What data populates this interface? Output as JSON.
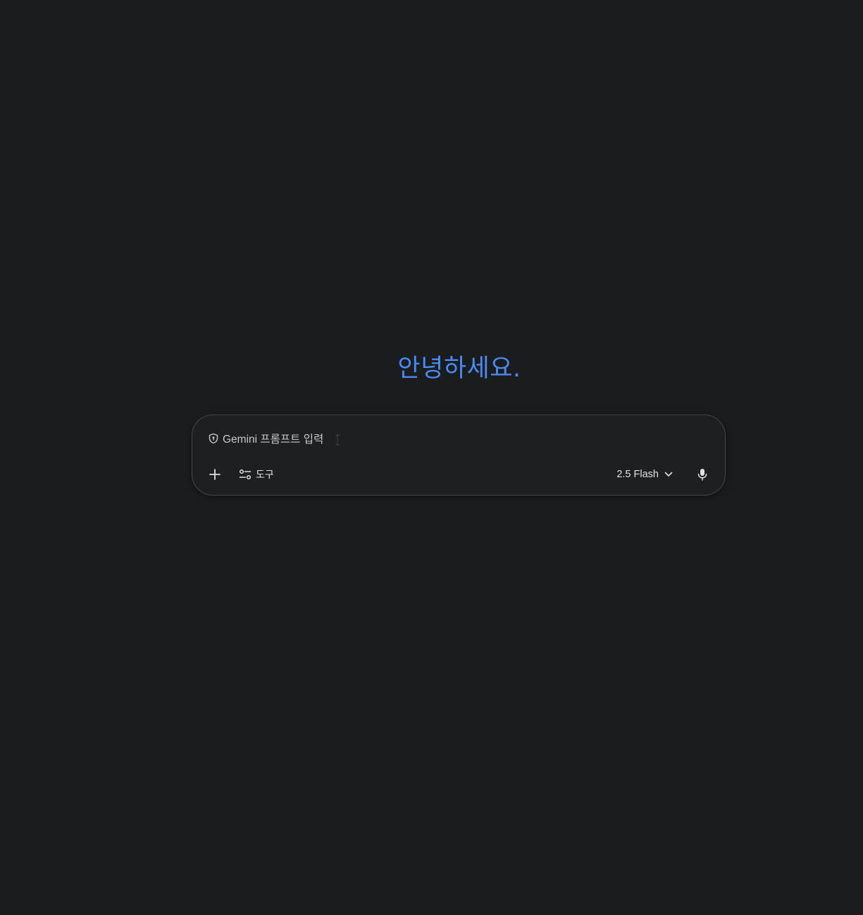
{
  "main": {
    "greeting": "안녕하세요."
  },
  "prompt": {
    "placeholder": "Gemini 프롬프트 입력"
  },
  "toolbar": {
    "add_icon": "plus-icon",
    "tools_icon": "sliders-icon",
    "tools_label": "도구",
    "model_label": "2.5 Flash",
    "model_dropdown_icon": "chevron-down-icon",
    "mic_icon": "microphone-icon"
  },
  "colors": {
    "background": "#1b1c1d",
    "greeting": "#4a8af4",
    "card_border": "#444746",
    "text": "#dfe1e5"
  }
}
